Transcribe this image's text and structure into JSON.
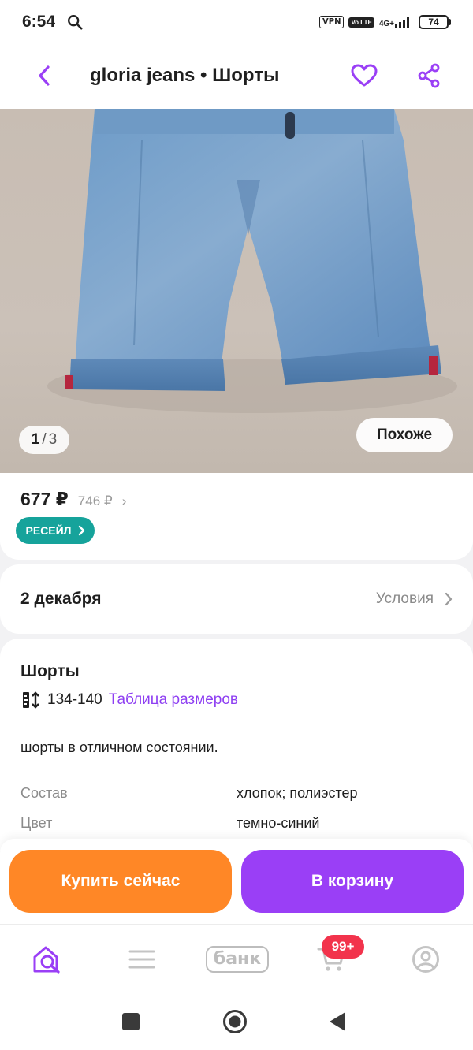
{
  "status_bar": {
    "time": "6:54",
    "vpn_label": "VPN",
    "volte_label": "Vo LTE",
    "network_label": "4G+",
    "battery_level": "74"
  },
  "header": {
    "title": "gloria jeans • Шорты",
    "back_icon": "chevron-left-icon",
    "favorite_icon": "heart-icon",
    "share_icon": "share-icon",
    "accent_color": "#9a3ff6"
  },
  "gallery": {
    "current_page": "1",
    "page_separator": "/",
    "total_pages": "3",
    "similar_label": "Похоже"
  },
  "price": {
    "current": "677 ₽",
    "old": "746 ₽",
    "chevron": "›",
    "resale_label": "РЕСЕЙЛ",
    "resale_color": "#16a39b"
  },
  "delivery": {
    "date": "2 декабря",
    "conditions_label": "Условия"
  },
  "details": {
    "title": "Шорты",
    "size": "134-140",
    "size_table_label": "Таблица размеров",
    "description": "шорты в отличном состоянии.",
    "attributes": [
      {
        "label": "Состав",
        "value": "хлопок; полиэстер"
      },
      {
        "label": "Цвет",
        "value": "темно-синий"
      }
    ]
  },
  "actions": {
    "buy_now_label": "Купить сейчас",
    "add_to_cart_label": "В корзину",
    "buy_now_color": "#ff8726",
    "add_to_cart_color": "#9a3ff6"
  },
  "bottom_nav": {
    "items": [
      {
        "name": "home-search",
        "icon": "home-search-icon"
      },
      {
        "name": "catalog",
        "icon": "menu-icon"
      },
      {
        "name": "bank",
        "label": "банк"
      },
      {
        "name": "cart",
        "icon": "cart-icon"
      },
      {
        "name": "profile",
        "icon": "profile-icon"
      }
    ],
    "cart_badge": "99+"
  }
}
